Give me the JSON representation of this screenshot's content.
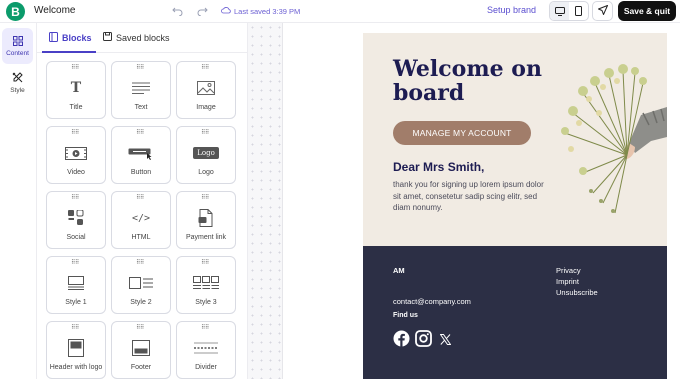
{
  "header": {
    "logo_letter": "B",
    "title": "Welcome",
    "saved_text": "Last saved 3:39 PM",
    "setup_brand": "Setup brand",
    "save_quit": "Save & quit"
  },
  "rail": {
    "items": [
      {
        "label": "Content",
        "icon": "grid-icon"
      },
      {
        "label": "Style",
        "icon": "paint-brush-icon"
      }
    ]
  },
  "panel": {
    "tabs": [
      {
        "label": "Blocks",
        "icon": "blocks-icon"
      },
      {
        "label": "Saved blocks",
        "icon": "save-icon"
      }
    ],
    "blocks": [
      {
        "label": "Title",
        "icon": "title-icon"
      },
      {
        "label": "Text",
        "icon": "text-lines-icon"
      },
      {
        "label": "Image",
        "icon": "image-icon"
      },
      {
        "label": "Video",
        "icon": "video-icon"
      },
      {
        "label": "Button",
        "icon": "button-icon"
      },
      {
        "label": "Logo",
        "icon": "logo-icon",
        "icon_text": "Logo"
      },
      {
        "label": "Social",
        "icon": "social-icon"
      },
      {
        "label": "HTML",
        "icon": "code-icon",
        "icon_text": "</>"
      },
      {
        "label": "Payment link",
        "icon": "payment-link-icon"
      },
      {
        "label": "Style 1",
        "icon": "layout-style1-icon"
      },
      {
        "label": "Style 2",
        "icon": "layout-style2-icon"
      },
      {
        "label": "Style 3",
        "icon": "layout-style3-icon"
      },
      {
        "label": "Header with logo",
        "icon": "header-logo-icon"
      },
      {
        "label": "Footer",
        "icon": "footer-icon"
      },
      {
        "label": "Divider",
        "icon": "divider-icon"
      }
    ]
  },
  "email": {
    "headline": "Welcome on board",
    "cta": "MANAGE MY ACCOUNT",
    "greeting": "Dear Mrs Smith,",
    "body": "thank you for signing up lorem ipsum dolor sit amet, consetetur sadip scing elitr, sed diam nonumy.",
    "footer": {
      "brand": "AM",
      "links": [
        "Privacy",
        "Imprint",
        "Unsubscribe"
      ],
      "email": "contact@company.com",
      "find_us": "Find us"
    }
  },
  "colors": {
    "accent": "#4a40c6",
    "hero_bg": "#f1ebe3",
    "cta_bg": "#a17d6a",
    "footer_bg": "#2c2f45",
    "headline": "#1d1c52"
  }
}
